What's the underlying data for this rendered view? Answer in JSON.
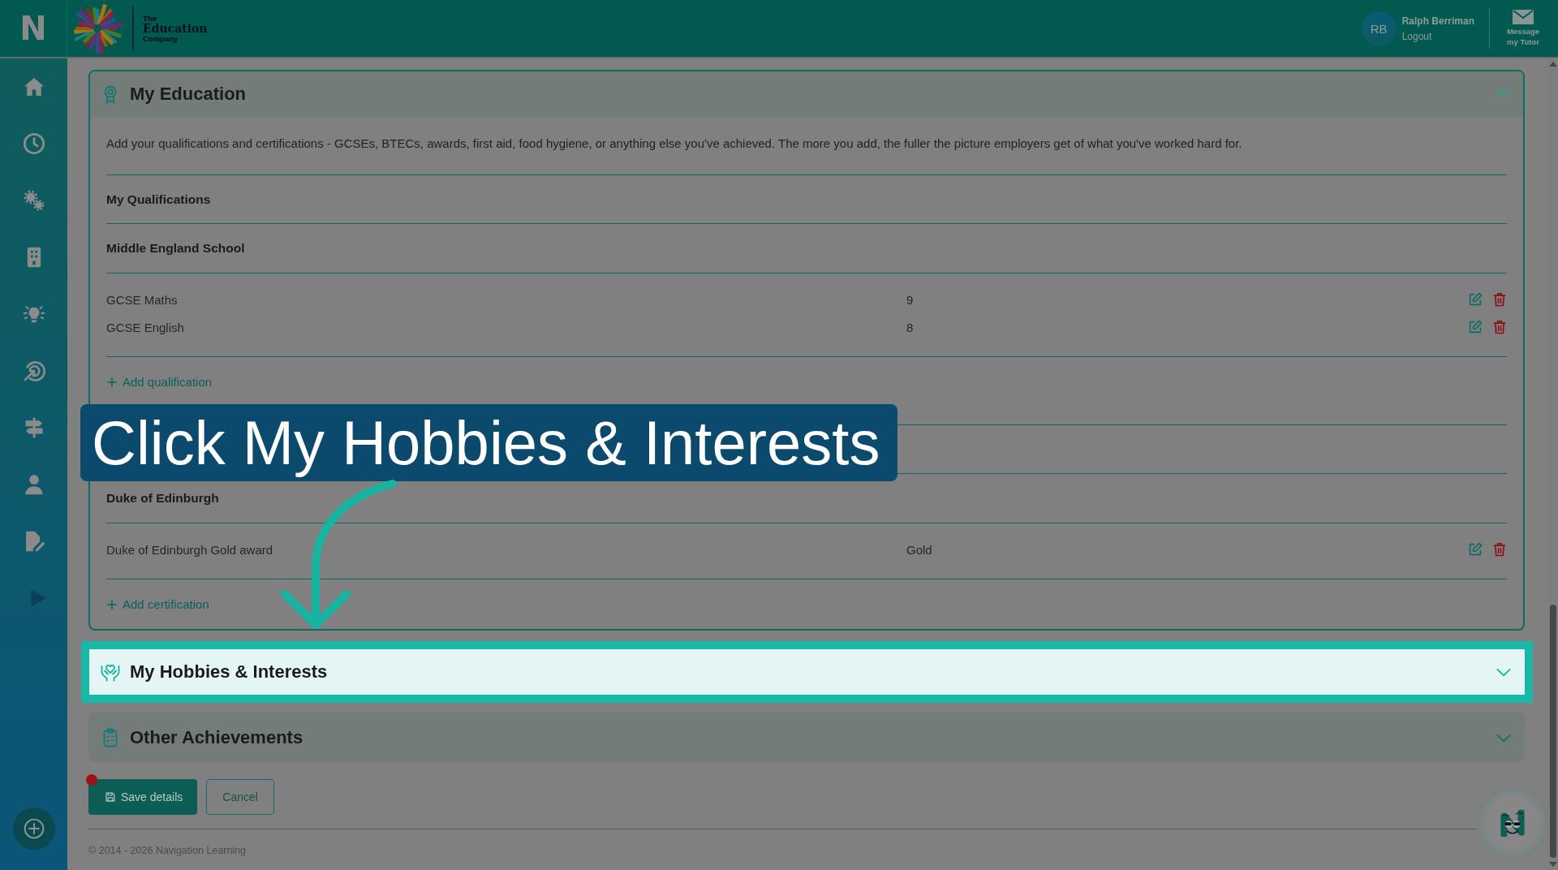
{
  "top_bar": {
    "app_logo": "N",
    "brand": {
      "top": "The",
      "name": "Education",
      "bottom": "Company"
    },
    "user": {
      "initials": "RB",
      "name": "Ralph Berriman",
      "logout": "Logout"
    },
    "message_button": "Message my Tutor"
  },
  "sections": [
    {
      "title": "My Education",
      "expanded": true,
      "highlighted": false,
      "description": "Add your qualifications and certifications - GCSEs, BTECs, awards, first aid, food hygiene, or anything else you've achieved. The more you add, the fuller the picture employers get of what you've worked hard for.",
      "groups": [
        {
          "heading": "My Qualifications",
          "providers": [
            {
              "name": "Middle England School",
              "items": [
                {
                  "name": "GCSE Maths",
                  "grade": "9"
                },
                {
                  "name": "GCSE English",
                  "grade": "8"
                }
              ]
            }
          ],
          "add_label": "Add qualification"
        },
        {
          "providers": [
            {
              "name": "Duke of Edinburgh",
              "items": [
                {
                  "name": "Duke of Edinburgh Gold award",
                  "grade": "Gold"
                }
              ]
            }
          ],
          "add_label": "Add certification"
        }
      ]
    },
    {
      "title": "My Hobbies & Interests",
      "expanded": false,
      "highlighted": true
    },
    {
      "title": "Other Achievements",
      "expanded": false,
      "highlighted": false
    }
  ],
  "buttons": [
    {
      "label": "Save details",
      "kind": "primary",
      "dot": true
    },
    {
      "label": "Cancel",
      "kind": "secondary",
      "dot": false
    }
  ],
  "footer": "© 2014 - 2026 Navigation Learning",
  "annotation": {
    "text": "Click My Hobbies & Interests"
  }
}
